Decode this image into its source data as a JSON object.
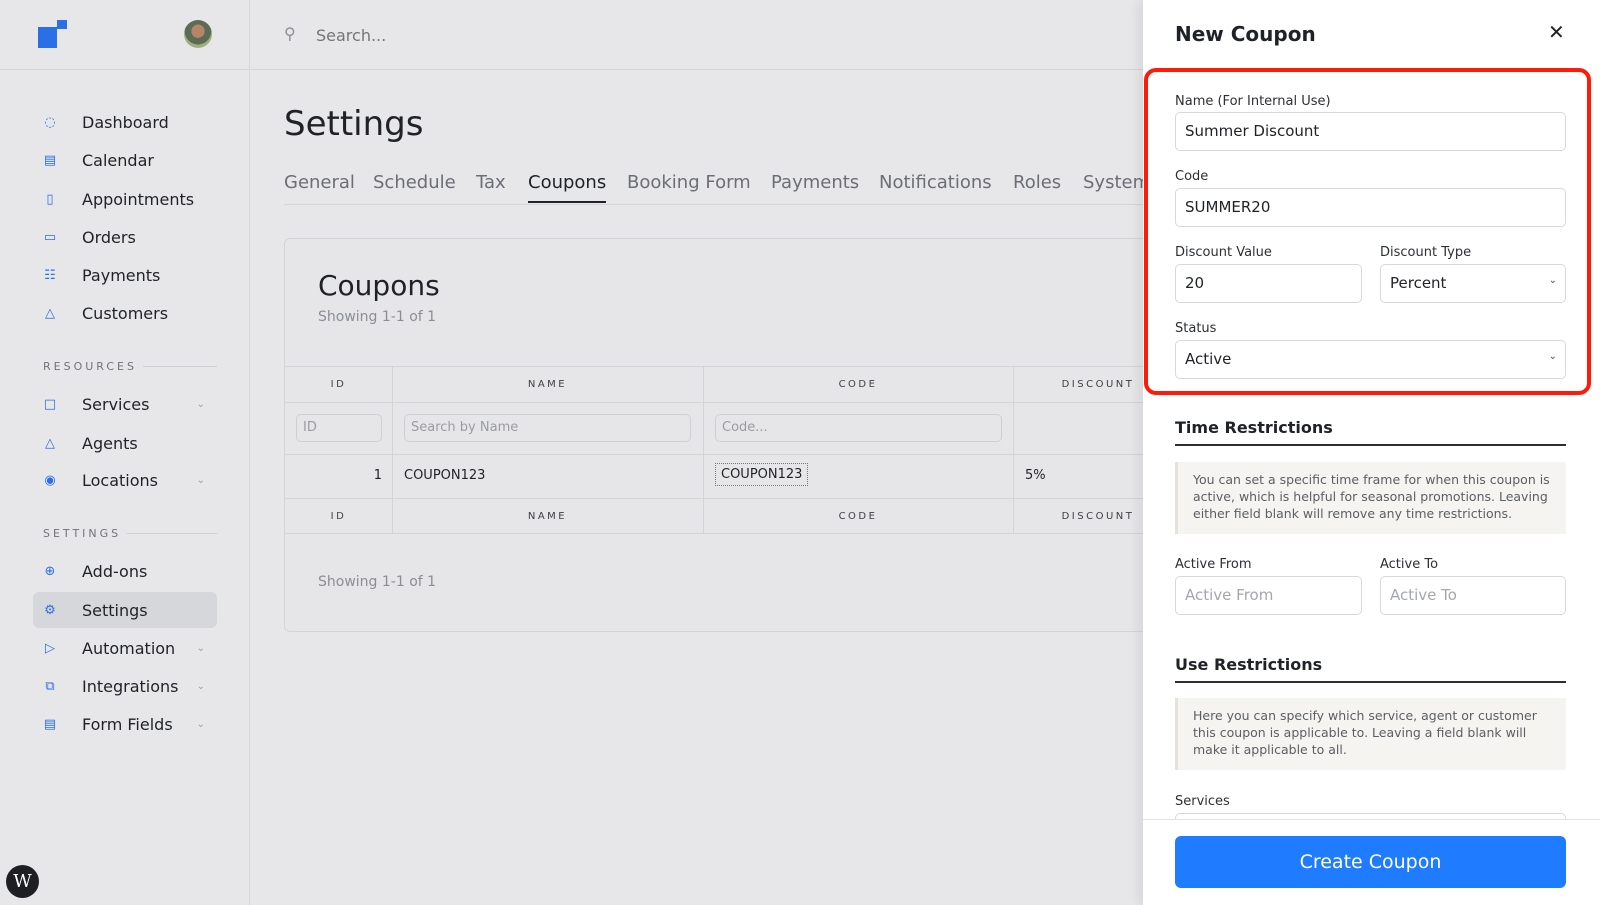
{
  "sidebar": {
    "main_items": [
      {
        "label": "Dashboard",
        "icon": "gauge-icon"
      },
      {
        "label": "Calendar",
        "icon": "calendar-icon"
      },
      {
        "label": "Appointments",
        "icon": "inbox-icon"
      },
      {
        "label": "Orders",
        "icon": "book-icon"
      },
      {
        "label": "Payments",
        "icon": "cart-icon"
      },
      {
        "label": "Customers",
        "icon": "user-icon"
      }
    ],
    "resources_label": "RESOURCES",
    "resources_items": [
      {
        "label": "Services",
        "icon": "folder-icon"
      },
      {
        "label": "Agents",
        "icon": "user-icon"
      },
      {
        "label": "Locations",
        "icon": "pin-icon"
      }
    ],
    "settings_label": "SETTINGS",
    "settings_items": [
      {
        "label": "Add-ons",
        "icon": "plus-circle-icon"
      },
      {
        "label": "Settings",
        "icon": "gear-icon"
      },
      {
        "label": "Automation",
        "icon": "play-icon"
      },
      {
        "label": "Integrations",
        "icon": "link-icon"
      },
      {
        "label": "Form Fields",
        "icon": "form-icon"
      }
    ],
    "active_item": "Settings"
  },
  "search": {
    "placeholder": "Search..."
  },
  "page": {
    "title": "Settings",
    "tabs": [
      "General",
      "Schedule",
      "Tax",
      "Coupons",
      "Booking Form",
      "Payments",
      "Notifications",
      "Roles",
      "System"
    ],
    "active_tab": "Coupons"
  },
  "coupons": {
    "title": "Coupons",
    "showing": "Showing 1-1 of 1",
    "columns": [
      "ID",
      "NAME",
      "CODE",
      "DISCOUNT"
    ],
    "filters": {
      "id": "ID",
      "name": "Search by Name",
      "code": "Code..."
    },
    "rows": [
      {
        "id": "1",
        "name": "COUPON123",
        "code": "COUPON123",
        "discount": "5%"
      }
    ],
    "footer_showing": "Showing 1-1 of 1"
  },
  "panel": {
    "title": "New Coupon",
    "name_label": "Name (For Internal Use)",
    "name_value": "Summer Discount",
    "code_label": "Code",
    "code_value": "SUMMER20",
    "discount_value_label": "Discount Value",
    "discount_value": "20",
    "discount_type_label": "Discount Type",
    "discount_type": "Percent",
    "status_label": "Status",
    "status": "Active",
    "time_title": "Time Restrictions",
    "time_info": "You can set a specific time frame for when this coupon is active, which is helpful for seasonal promotions. Leaving either field blank will remove any time restrictions.",
    "active_from_label": "Active From",
    "active_from_placeholder": "Active From",
    "active_to_label": "Active To",
    "active_to_placeholder": "Active To",
    "use_title": "Use Restrictions",
    "use_info": "Here you can specify which service, agent or customer this coupon is applicable to. Leaving a field blank will make it applicable to all.",
    "services_label": "Services",
    "submit": "Create Coupon"
  },
  "colors": {
    "accent": "#1f7bff",
    "highlight": "#ff1a0a"
  }
}
